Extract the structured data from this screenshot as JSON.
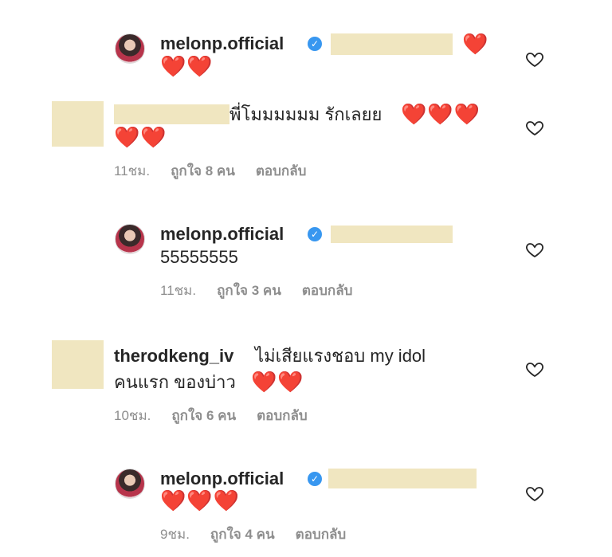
{
  "comments": [
    {
      "username": "melonp.official",
      "verified": true,
      "hearts_inline": "❤️",
      "hearts_line": "❤️❤️"
    },
    {
      "text": "พี่โมมมมมม รักเลยย",
      "hearts_inline": "❤️❤️❤️",
      "hearts_line": "❤️❤️",
      "time": "11ชม.",
      "likes": "ถูกใจ 8 คน",
      "reply": "ตอบกลับ"
    },
    {
      "username": "melonp.official",
      "verified": true,
      "text": "55555555",
      "time": "11ชม.",
      "likes": "ถูกใจ 3 คน",
      "reply": "ตอบกลับ"
    },
    {
      "username": "therodkeng_iv",
      "text_line1": "ไม่เสียแรงชอบ my idol",
      "text_line2": "คนแรก ของบ่าว",
      "hearts_inline": "❤️❤️",
      "time": "10ชม.",
      "likes": "ถูกใจ 6 คน",
      "reply": "ตอบกลับ"
    },
    {
      "username": "melonp.official",
      "verified": true,
      "hearts_line": "❤️❤️❤️",
      "time": "9ชม.",
      "likes": "ถูกใจ 4 คน",
      "reply": "ตอบกลับ"
    }
  ],
  "icons": {
    "like": "heart-outline-icon",
    "verified": "verified-badge-icon"
  },
  "colors": {
    "redaction": "#f0e6c0",
    "meta_text": "#8e8e8e",
    "verified": "#3897f0",
    "heart": "#ed2e3e"
  }
}
